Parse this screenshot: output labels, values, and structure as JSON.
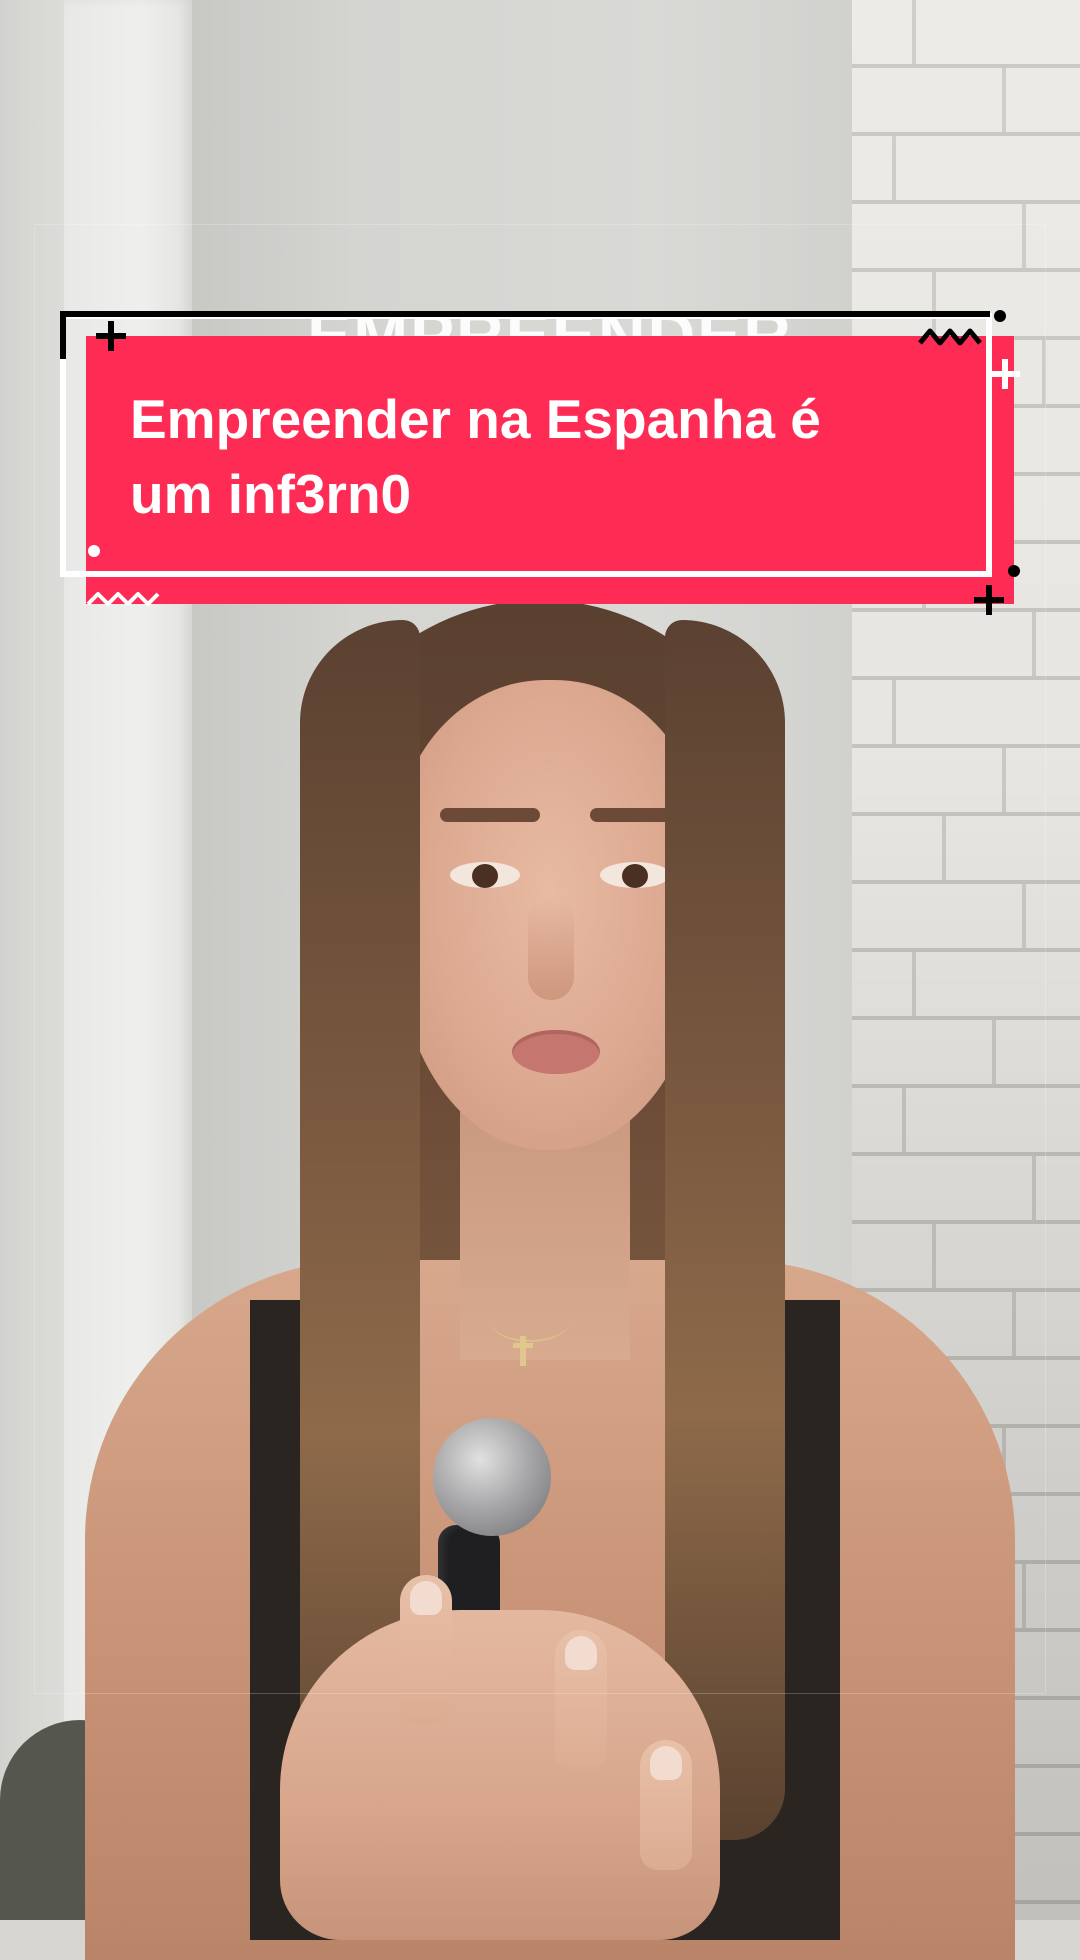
{
  "caption": {
    "line_1": "Empreender na Espanha é",
    "line_2": "um inf3rn0",
    "ghost_title": "EMPREENDER NA",
    "background_color": "#fe2c55",
    "text_color": "#ffffff",
    "frame_color": "#ffffff",
    "accent_color": "#000000"
  },
  "scene": {
    "subject": "person-speaking-to-camera",
    "props": [
      "lavalier-microphone",
      "cross-necklace"
    ],
    "background": "white-brick-wall"
  }
}
